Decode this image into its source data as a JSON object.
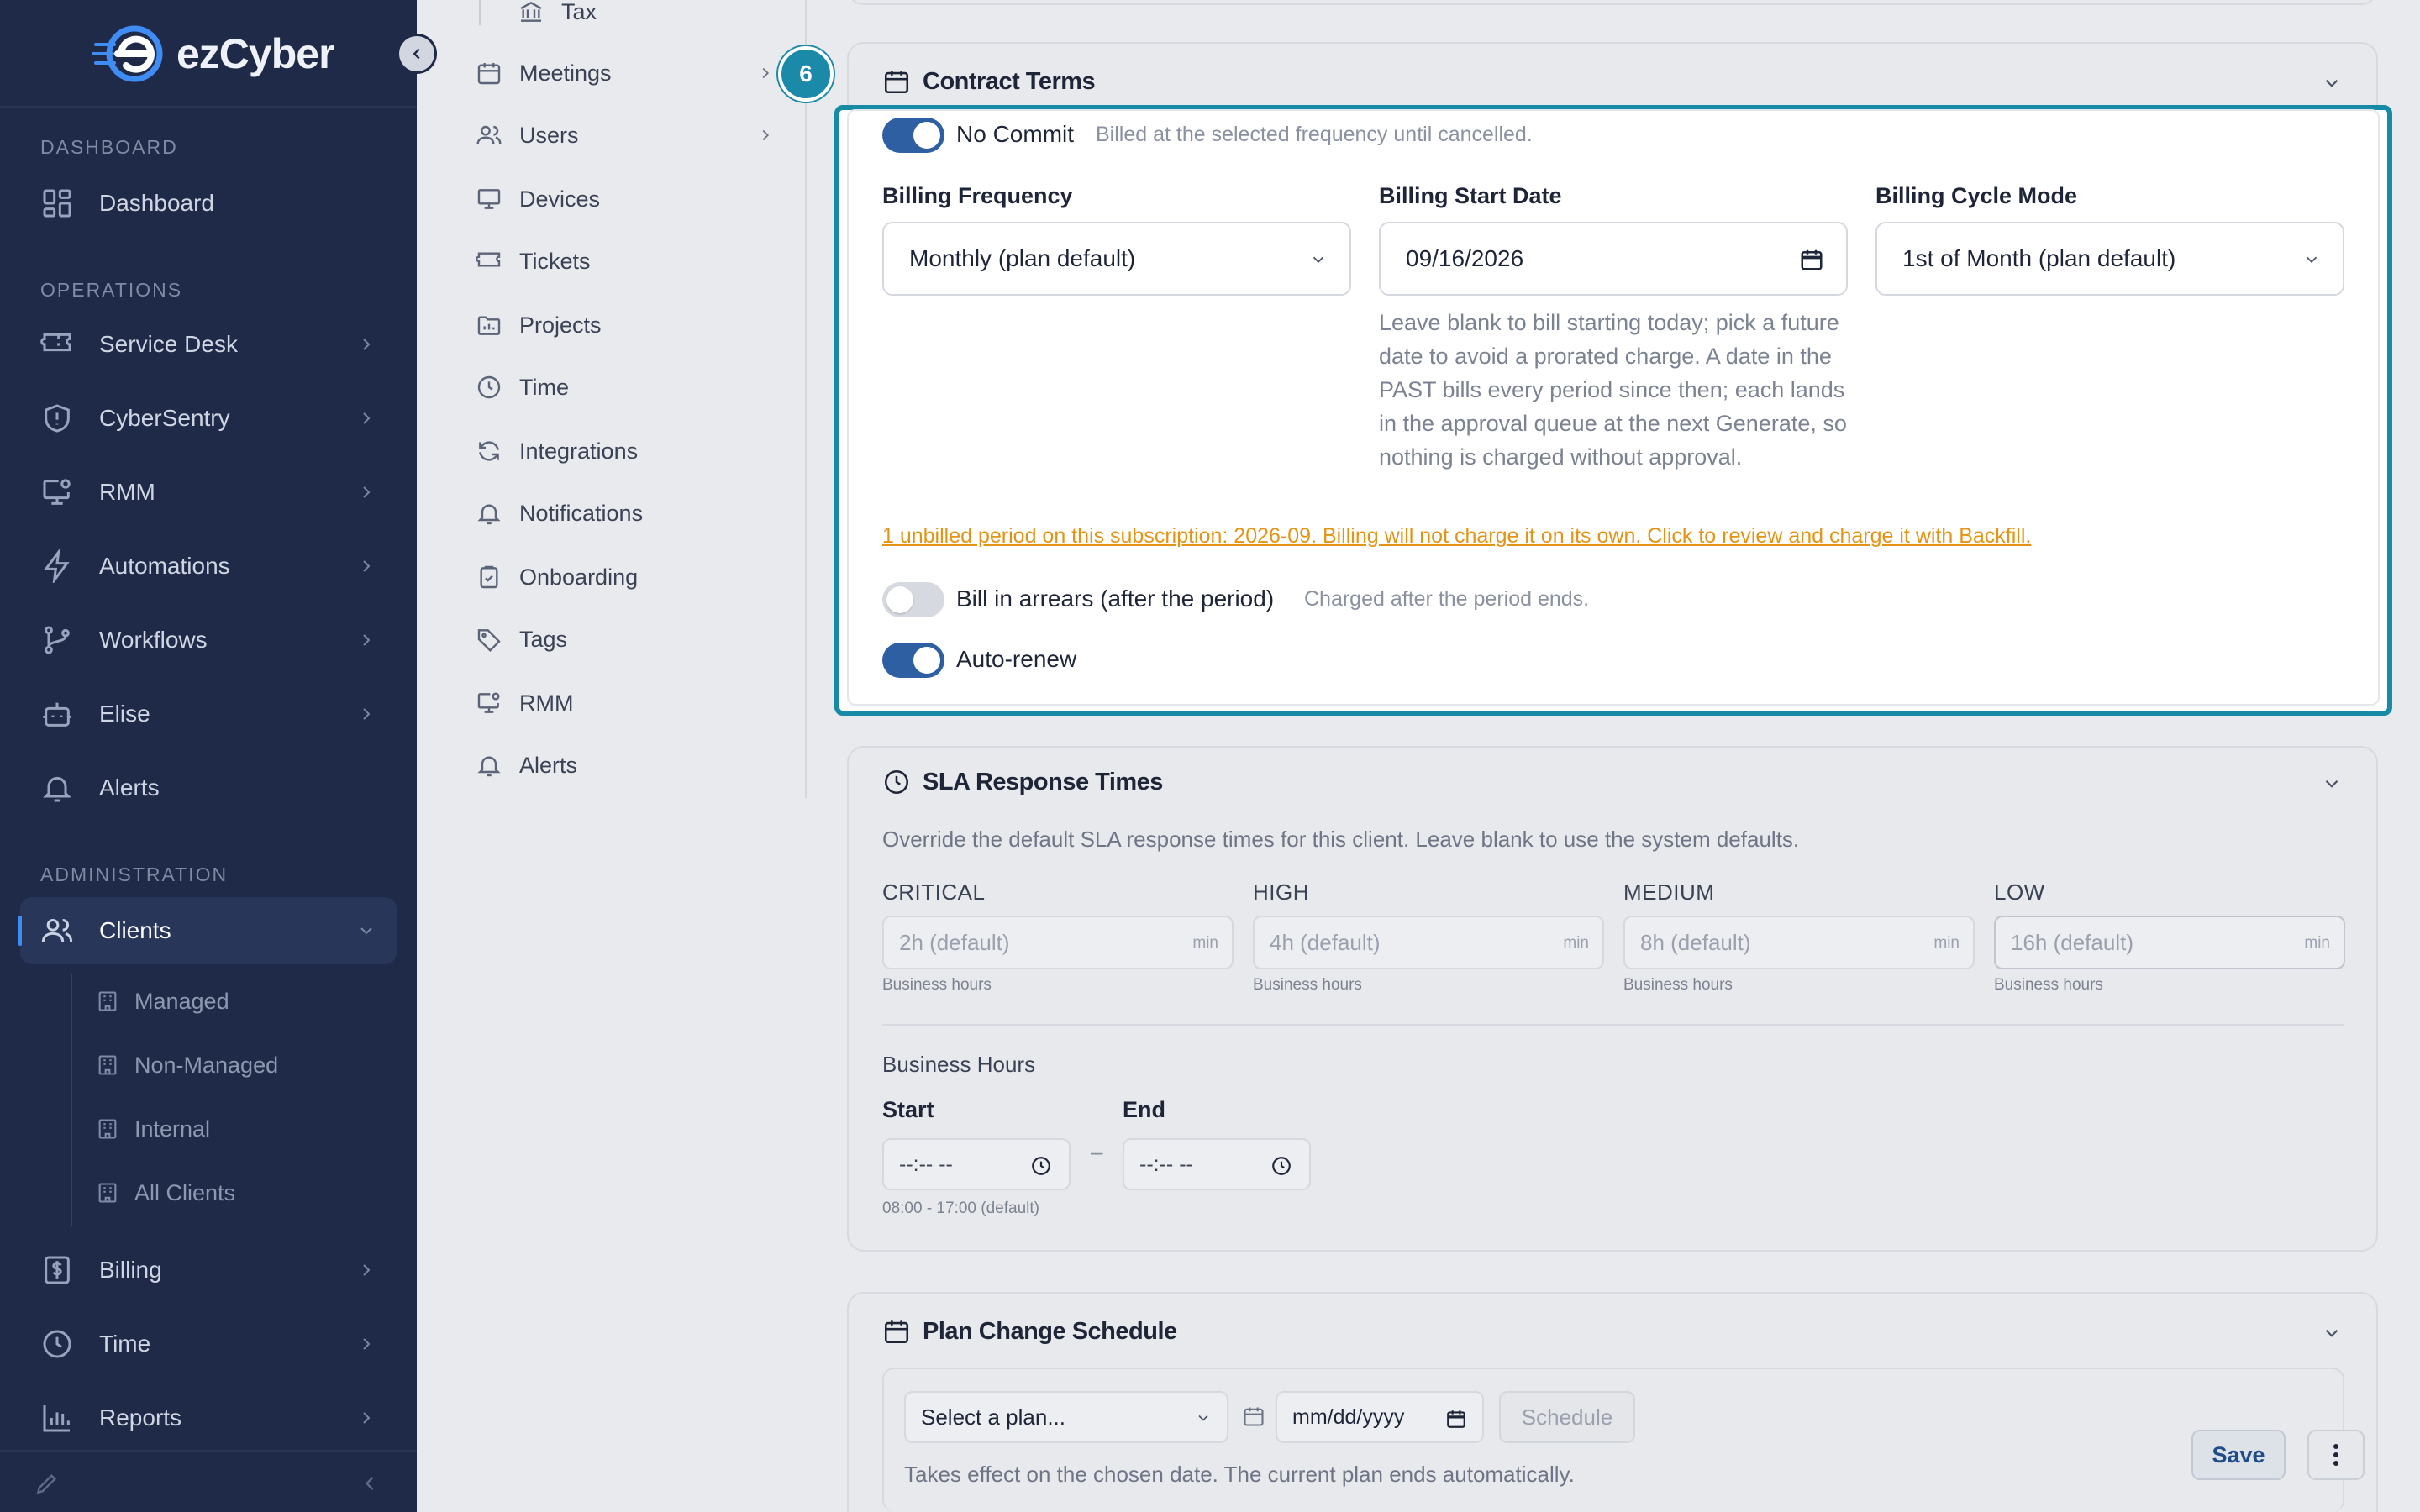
{
  "brand": {
    "name": "ezCyber",
    "accent": "#178aa6",
    "sidebar_bg": "#1e2a48",
    "warning": "#e49414"
  },
  "sidebar": {
    "sections": {
      "dashboard": "DASHBOARD",
      "operations": "OPERATIONS",
      "administration": "ADMINISTRATION"
    },
    "items": [
      {
        "label": "Dashboard",
        "icon": "grid-icon"
      },
      {
        "label": "Service Desk",
        "icon": "ticket-icon"
      },
      {
        "label": "CyberSentry",
        "icon": "shield-icon"
      },
      {
        "label": "RMM",
        "icon": "monitor-gear-icon"
      },
      {
        "label": "Automations",
        "icon": "bolt-icon"
      },
      {
        "label": "Workflows",
        "icon": "workflow-icon"
      },
      {
        "label": "Elise",
        "icon": "bot-icon"
      },
      {
        "label": "Alerts",
        "icon": "bell-icon"
      },
      {
        "label": "Clients",
        "icon": "users-icon"
      },
      {
        "label": "Billing",
        "icon": "dollar-icon"
      },
      {
        "label": "Time",
        "icon": "clock-icon"
      },
      {
        "label": "Reports",
        "icon": "bar-chart-icon"
      }
    ],
    "clients_sub": [
      "Managed",
      "Non-Managed",
      "Internal",
      "All Clients"
    ]
  },
  "settings_nav": {
    "items": [
      {
        "label": "Tax",
        "icon": "bank-icon"
      },
      {
        "label": "Meetings",
        "icon": "calendar-icon"
      },
      {
        "label": "Users",
        "icon": "users-icon"
      },
      {
        "label": "Devices",
        "icon": "monitor-icon"
      },
      {
        "label": "Tickets",
        "icon": "ticket-icon"
      },
      {
        "label": "Projects",
        "icon": "folder-icon"
      },
      {
        "label": "Time",
        "icon": "clock-icon"
      },
      {
        "label": "Integrations",
        "icon": "refresh-icon"
      },
      {
        "label": "Notifications",
        "icon": "bell-icon"
      },
      {
        "label": "Onboarding",
        "icon": "clipboard-icon"
      },
      {
        "label": "Tags",
        "icon": "tag-icon"
      },
      {
        "label": "RMM",
        "icon": "monitor-gear-icon"
      },
      {
        "label": "Alerts",
        "icon": "bell-icon"
      }
    ]
  },
  "step_badge": "6",
  "contract": {
    "title": "Contract Terms",
    "no_commit_label": "No Commit",
    "no_commit_desc": "Billed at the selected frequency until cancelled.",
    "billing_frequency_label": "Billing Frequency",
    "billing_frequency_value": "Monthly (plan default)",
    "billing_start_label": "Billing Start Date",
    "billing_start_value": "09/16/2026",
    "billing_cycle_label": "Billing Cycle Mode",
    "billing_cycle_value": "1st of Month (plan default)",
    "help": "Leave blank to bill starting today; pick a future date to avoid a prorated charge. A date in the PAST bills every period since then; each lands in the approval queue at the next Generate, so nothing is charged without approval.",
    "warning": "1 unbilled period on this subscription: 2026-09. Billing will not charge it on its own. Click to review and charge it with Backfill.",
    "arrears_label": "Bill in arrears (after the period)",
    "arrears_desc": "Charged after the period ends.",
    "autorenew_label": "Auto-renew",
    "toggles": {
      "no_commit": true,
      "arrears": false,
      "auto_renew": true
    }
  },
  "sla": {
    "title": "SLA Response Times",
    "desc": "Override the default SLA response times for this client. Leave blank to use the system defaults.",
    "priorities": [
      {
        "label": "CRITICAL",
        "placeholder": "2h (default)",
        "unit": "min",
        "hint": "Business hours"
      },
      {
        "label": "HIGH",
        "placeholder": "4h (default)",
        "unit": "min",
        "hint": "Business hours"
      },
      {
        "label": "MEDIUM",
        "placeholder": "8h (default)",
        "unit": "min",
        "hint": "Business hours"
      },
      {
        "label": "LOW",
        "placeholder": "16h (default)",
        "unit": "min",
        "hint": "Business hours"
      }
    ],
    "business_hours_label": "Business Hours",
    "start_label": "Start",
    "end_label": "End",
    "time_placeholder": "--:-- --",
    "separator": "–",
    "default_hours": "08:00 - 17:00 (default)"
  },
  "plan_change": {
    "title": "Plan Change Schedule",
    "select_placeholder": "Select a plan...",
    "date_placeholder": "mm/dd/yyyy",
    "schedule_label": "Schedule",
    "desc": "Takes effect on the chosen date. The current plan ends automatically."
  },
  "actions": {
    "save": "Save"
  }
}
